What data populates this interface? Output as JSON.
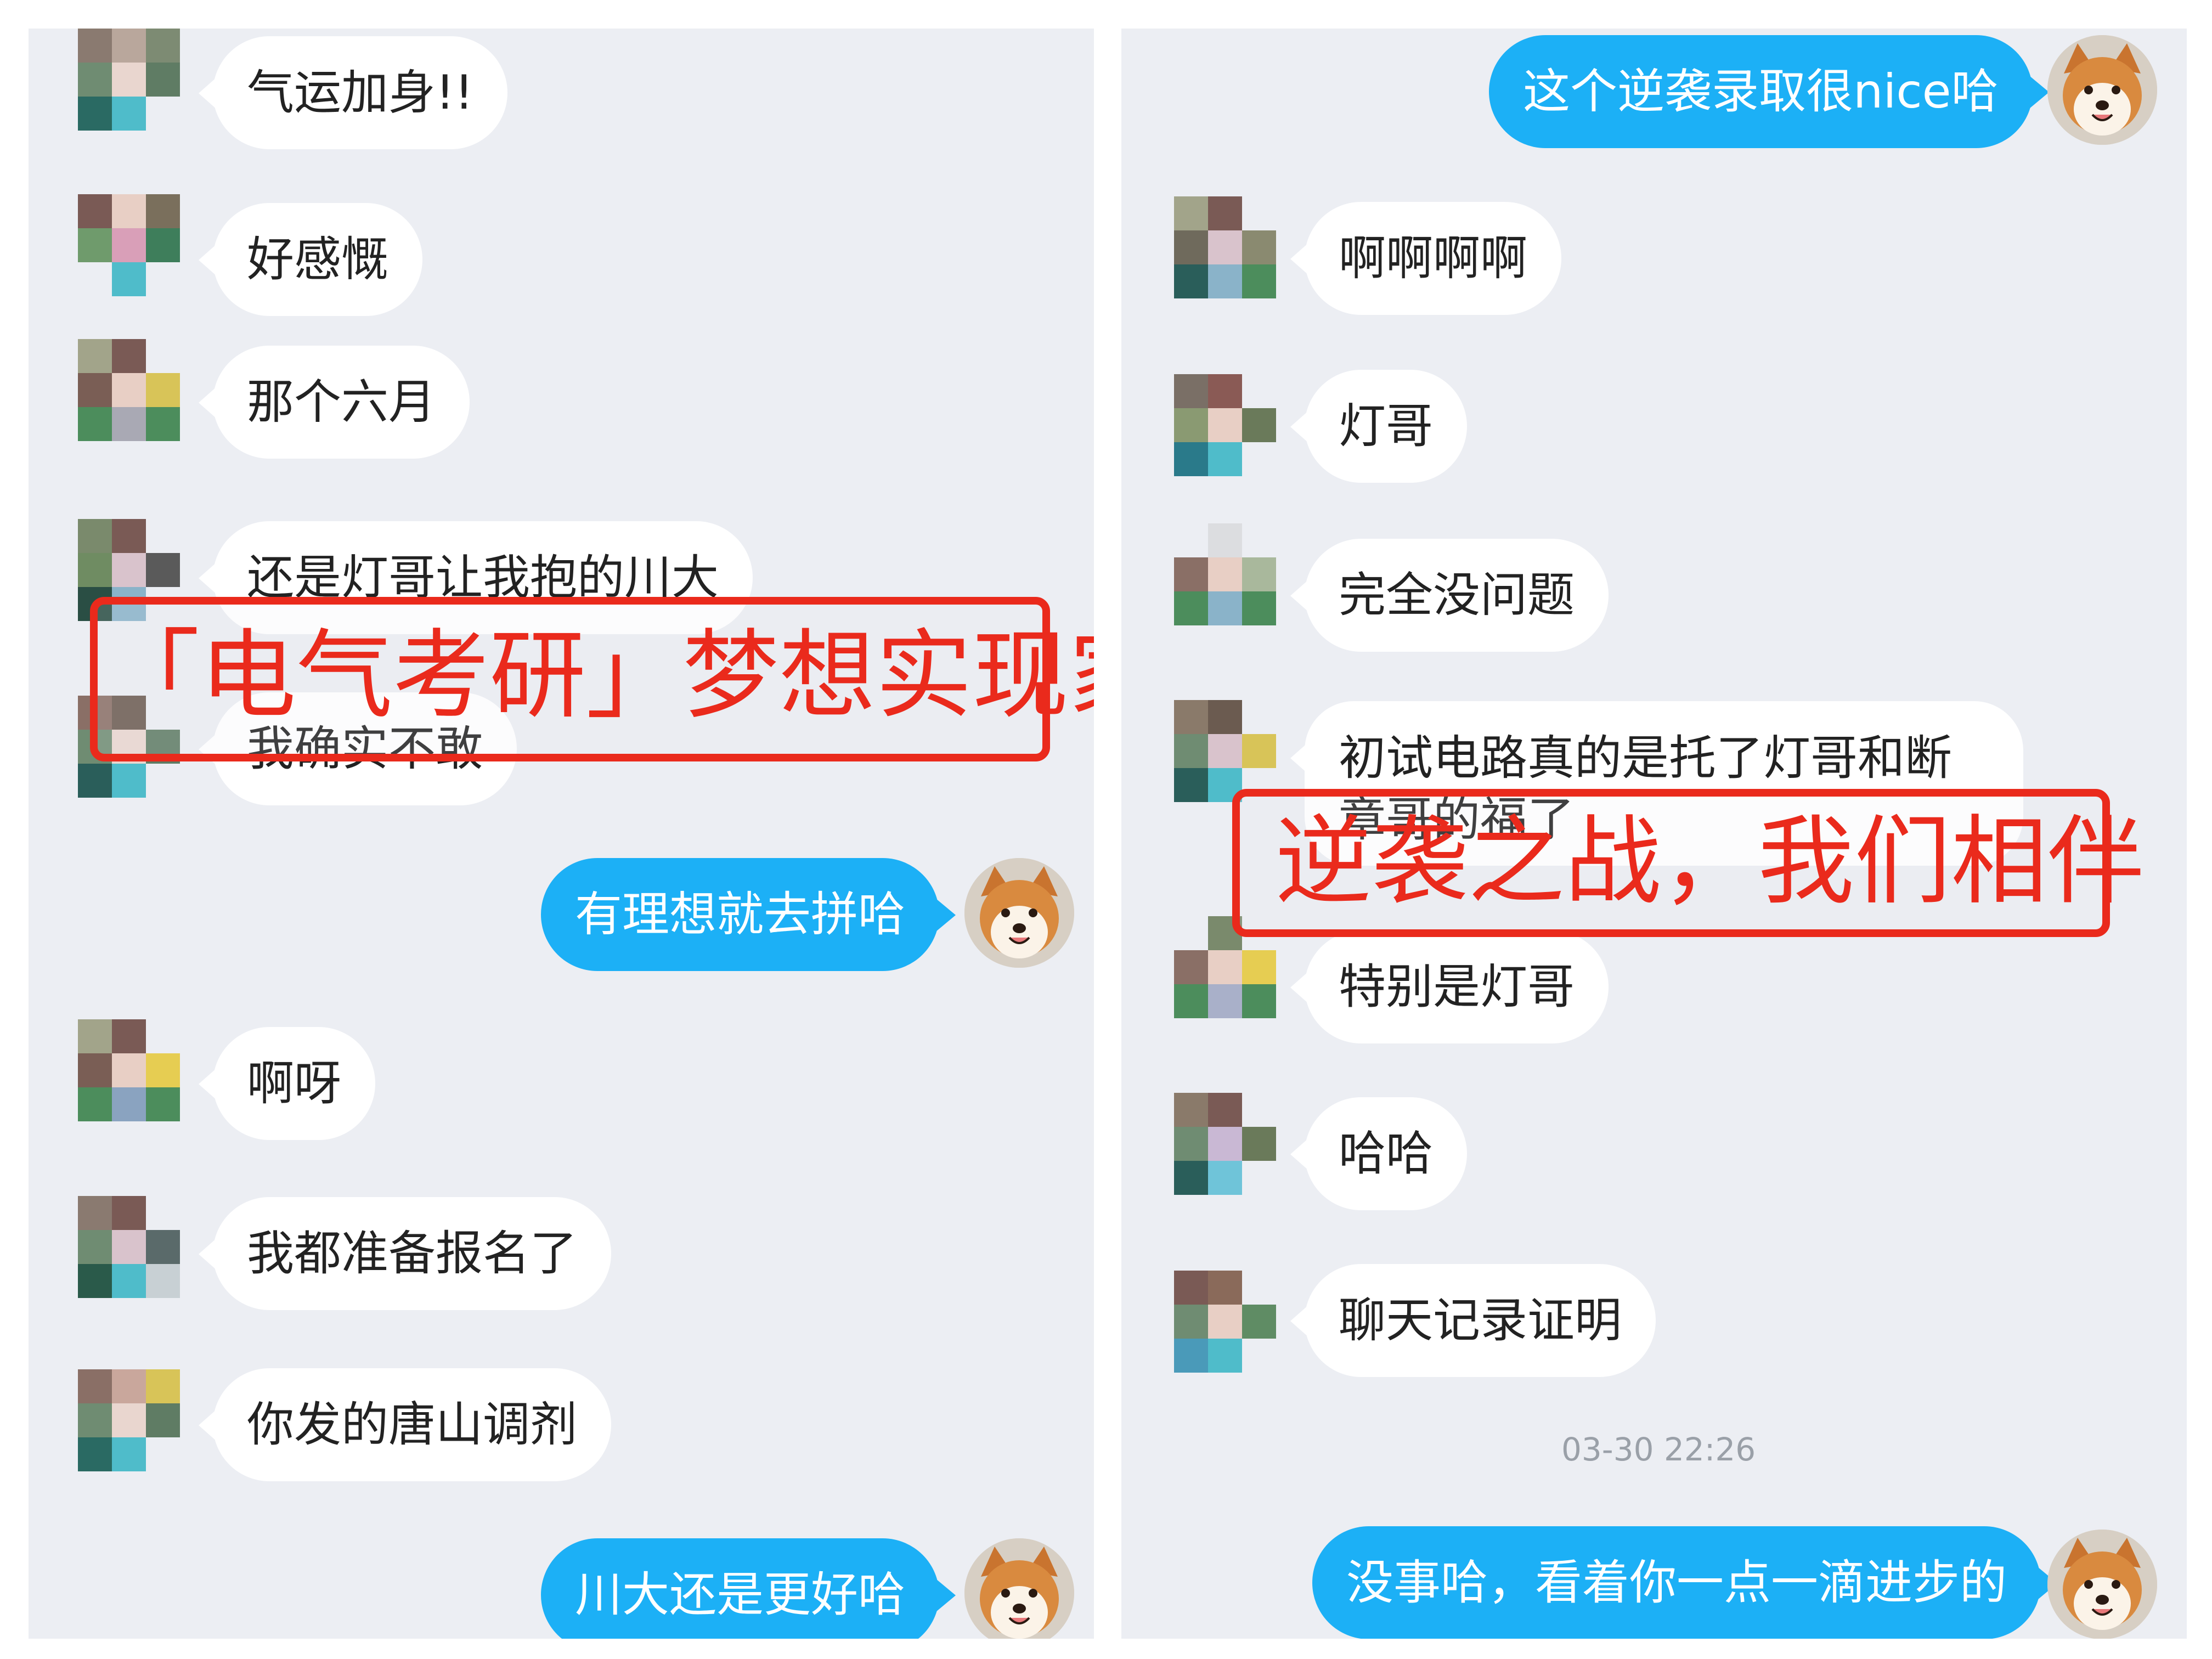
{
  "left_panel": {
    "messages": [
      {
        "side": "theirs",
        "text": "气运加身!!"
      },
      {
        "side": "theirs",
        "text": "好感慨"
      },
      {
        "side": "theirs",
        "text": "那个六月"
      },
      {
        "side": "theirs",
        "text": "还是灯哥让我抱的川大"
      },
      {
        "side": "theirs",
        "text": "我确实不敢"
      },
      {
        "side": "mine",
        "text": "有理想就去拼哈"
      },
      {
        "side": "theirs",
        "text": "啊呀"
      },
      {
        "side": "theirs",
        "text": "我都准备报名了"
      },
      {
        "side": "theirs",
        "text": "你发的唐山调剂"
      },
      {
        "side": "mine",
        "text": "川大还是更好哈"
      }
    ],
    "overlay_caption": "「电气考研」梦想实现家"
  },
  "right_panel": {
    "messages": [
      {
        "side": "mine",
        "text": "这个逆袭录取很nice哈"
      },
      {
        "side": "theirs",
        "text": "啊啊啊啊"
      },
      {
        "side": "theirs",
        "text": "灯哥"
      },
      {
        "side": "theirs",
        "text": "完全没问题"
      },
      {
        "side": "theirs",
        "text": "初试电路真的是托了灯哥和断章哥的福了"
      },
      {
        "side": "theirs",
        "text": "特别是灯哥"
      },
      {
        "side": "theirs",
        "text": "哈哈"
      },
      {
        "side": "theirs",
        "text": "聊天记录证明"
      },
      {
        "side": "mine",
        "text": "没事哈，看着你一点一滴进步的"
      }
    ],
    "timestamp": "03-30 22:26",
    "overlay_caption": "逆袭之战，我们相伴"
  },
  "colors": {
    "chat_background": "#eceef3",
    "my_bubble": "#1cb0f6",
    "their_bubble": "#ffffff",
    "annotation_red": "#ea2a1c"
  },
  "icons": {
    "their_avatar": "pixelated-avatar-icon",
    "my_avatar": "shiba-dog-avatar-icon"
  }
}
